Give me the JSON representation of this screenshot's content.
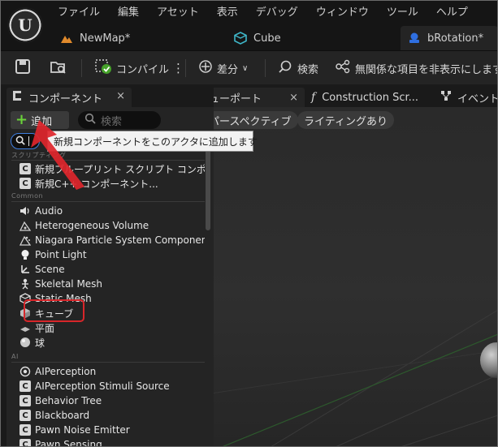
{
  "app": {
    "logo_text": "U",
    "menus": [
      "ファイル",
      "編集",
      "アセット",
      "表示",
      "デバッグ",
      "ウィンドウ",
      "ツール",
      "ヘルプ"
    ],
    "tabs": [
      {
        "label": "NewMap*",
        "icon": "level-icon",
        "active": false
      },
      {
        "label": "Cube",
        "icon": "cube-asset-icon",
        "active": false
      },
      {
        "label": "bRotation*",
        "icon": "blueprint-icon",
        "active": true
      }
    ]
  },
  "toolbar": {
    "compile_label": "コンパイル",
    "diff_label": "差分",
    "find_label": "検索",
    "hide_unrelated_label": "無関係な項目を非表示にします"
  },
  "components_panel": {
    "tab_label": "コンポーネント",
    "close_glyph": "×",
    "add_label": "追加",
    "search_placeholder": "検索",
    "search_value": "",
    "groups": [
      {
        "category": "スクリプティング",
        "items": [
          {
            "label": "新規ブループリント スクリプト コンポ",
            "icon": "c-class-icon"
          },
          {
            "label": "新規C++ コンポーネント...",
            "icon": "c-class-icon"
          }
        ]
      },
      {
        "category": "Common",
        "items": [
          {
            "label": "Audio",
            "icon": "speaker-icon"
          },
          {
            "label": "Heterogeneous Volume",
            "icon": "volume-icon"
          },
          {
            "label": "Niagara Particle System Component",
            "icon": "particle-icon"
          },
          {
            "label": "Point Light",
            "icon": "lightbulb-icon"
          },
          {
            "label": "Scene",
            "icon": "scene-icon"
          },
          {
            "label": "Skeletal Mesh",
            "icon": "skeleton-icon"
          },
          {
            "label": "Static Mesh",
            "icon": "static-mesh-icon"
          },
          {
            "label": "キューブ",
            "icon": "cube-icon"
          },
          {
            "label": "平面",
            "icon": "plane-icon"
          },
          {
            "label": "球",
            "icon": "sphere-icon"
          }
        ]
      },
      {
        "category": "AI",
        "items": [
          {
            "label": "AIPerception",
            "icon": "ai-perception-icon"
          },
          {
            "label": "AIPerception Stimuli Source",
            "icon": "c-class-icon"
          },
          {
            "label": "Behavior Tree",
            "icon": "c-class-icon"
          },
          {
            "label": "Blackboard",
            "icon": "c-class-icon"
          },
          {
            "label": "Pawn Noise Emitter",
            "icon": "c-class-icon"
          },
          {
            "label": "Pawn Sensing",
            "icon": "c-class-icon"
          }
        ]
      }
    ]
  },
  "tooltip": {
    "text": "新規コンポーネントをこのアクタに追加します"
  },
  "viewport": {
    "tabs": [
      {
        "label": "ビューポート",
        "icon": "viewport-icon"
      },
      {
        "label": "Construction Scr...",
        "icon": "function-icon"
      },
      {
        "label": "イベント",
        "icon": "graph-icon"
      }
    ],
    "menu_glyph": "≡",
    "perspective_label": "パースペクティブ",
    "lighting_label": "ライティングあり"
  },
  "colors": {
    "accent_green": "#6ad13a",
    "annotation_red": "#d8262a",
    "focus_blue": "#3f7fe0"
  }
}
